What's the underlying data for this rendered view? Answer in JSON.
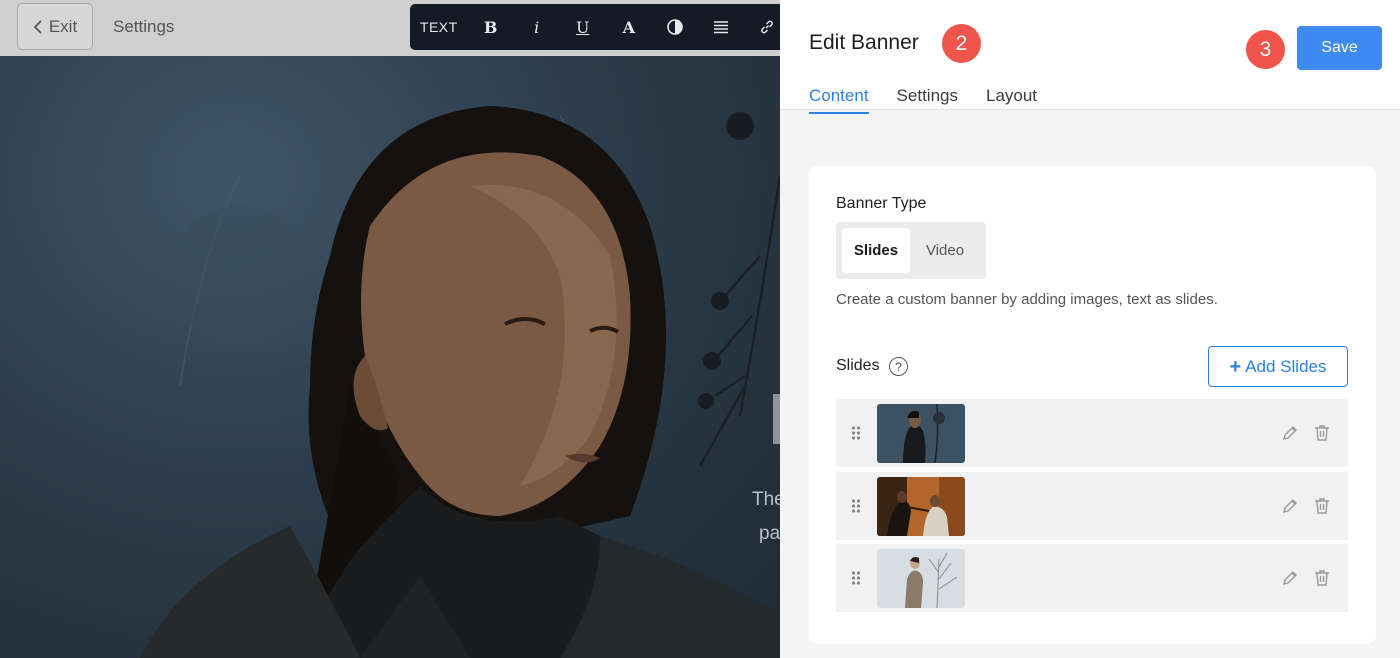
{
  "topbar": {
    "exit_label": "Exit",
    "settings_label": "Settings"
  },
  "format_toolbar": {
    "text_label": "TEXT",
    "bold_label": "B",
    "italic_label": "i",
    "underline_label": "U",
    "font_color_label": "A",
    "icons": [
      "bold-icon",
      "italic-icon",
      "underline-icon",
      "font-color-icon",
      "contrast-icon",
      "align-icon",
      "link-icon"
    ]
  },
  "canvas": {
    "overlay_line1": "The",
    "overlay_line2": "pa"
  },
  "panel": {
    "title": "Edit Banner",
    "step_badge_title": "2",
    "step_badge_save": "3",
    "save_label": "Save",
    "tabs": [
      {
        "label": "Content",
        "active": true
      },
      {
        "label": "Settings",
        "active": false
      },
      {
        "label": "Layout",
        "active": false
      }
    ],
    "banner_type": {
      "label": "Banner Type",
      "options": [
        "Slides",
        "Video"
      ],
      "selected": "Slides",
      "help": "Create a custom banner by adding images, text as slides."
    },
    "slides": {
      "label": "Slides",
      "help_icon": "?",
      "add_label": "Add Slides",
      "add_icon": "+",
      "items": [
        {
          "thumb": "woman-with-branch"
        },
        {
          "thumb": "people-in-warm-light"
        },
        {
          "thumb": "woman-in-coat-by-tree"
        }
      ]
    }
  },
  "colors": {
    "accent": "#2e7fe0",
    "save_button": "#3d8bf0",
    "step_badge": "#f0544a",
    "toolbar_bg": "#141a26"
  }
}
